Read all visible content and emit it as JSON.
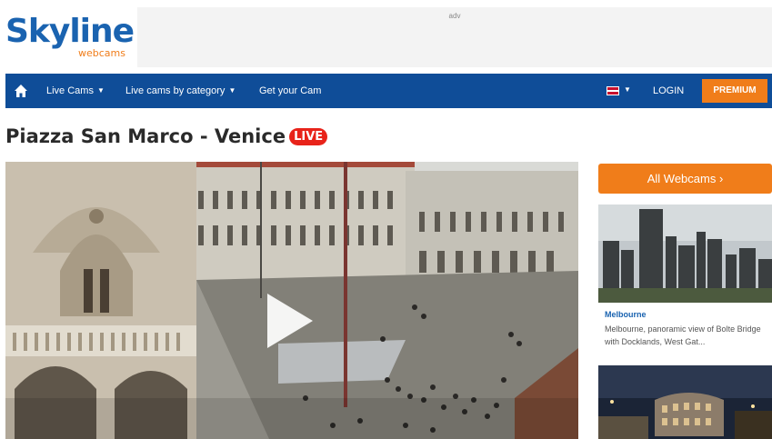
{
  "logo": {
    "main": "Skyline",
    "sub": "webcams"
  },
  "adv": {
    "label": "adv"
  },
  "nav": {
    "home_icon": "home-icon",
    "items": [
      {
        "label": "Live Cams"
      },
      {
        "label": "Live cams by category"
      },
      {
        "label": "Get your Cam"
      }
    ],
    "language_flag": "uk-flag-icon",
    "login": "LOGIN",
    "premium": "PREMIUM"
  },
  "page": {
    "title": "Piazza San Marco - Venice",
    "live_badge": "LIVE"
  },
  "video": {
    "play_icon": "play-icon"
  },
  "sidebar": {
    "all_webcams": "All Webcams ›",
    "cards": [
      {
        "title": "Melbourne",
        "description": "Melbourne, panoramic view of Bolte Bridge with Docklands, West Gat..."
      },
      {
        "title": "",
        "description": ""
      }
    ]
  },
  "colors": {
    "nav_blue": "#0f4d98",
    "brand_orange": "#f07d1a",
    "live_red": "#e8231a",
    "logo_blue": "#1a63b0"
  }
}
